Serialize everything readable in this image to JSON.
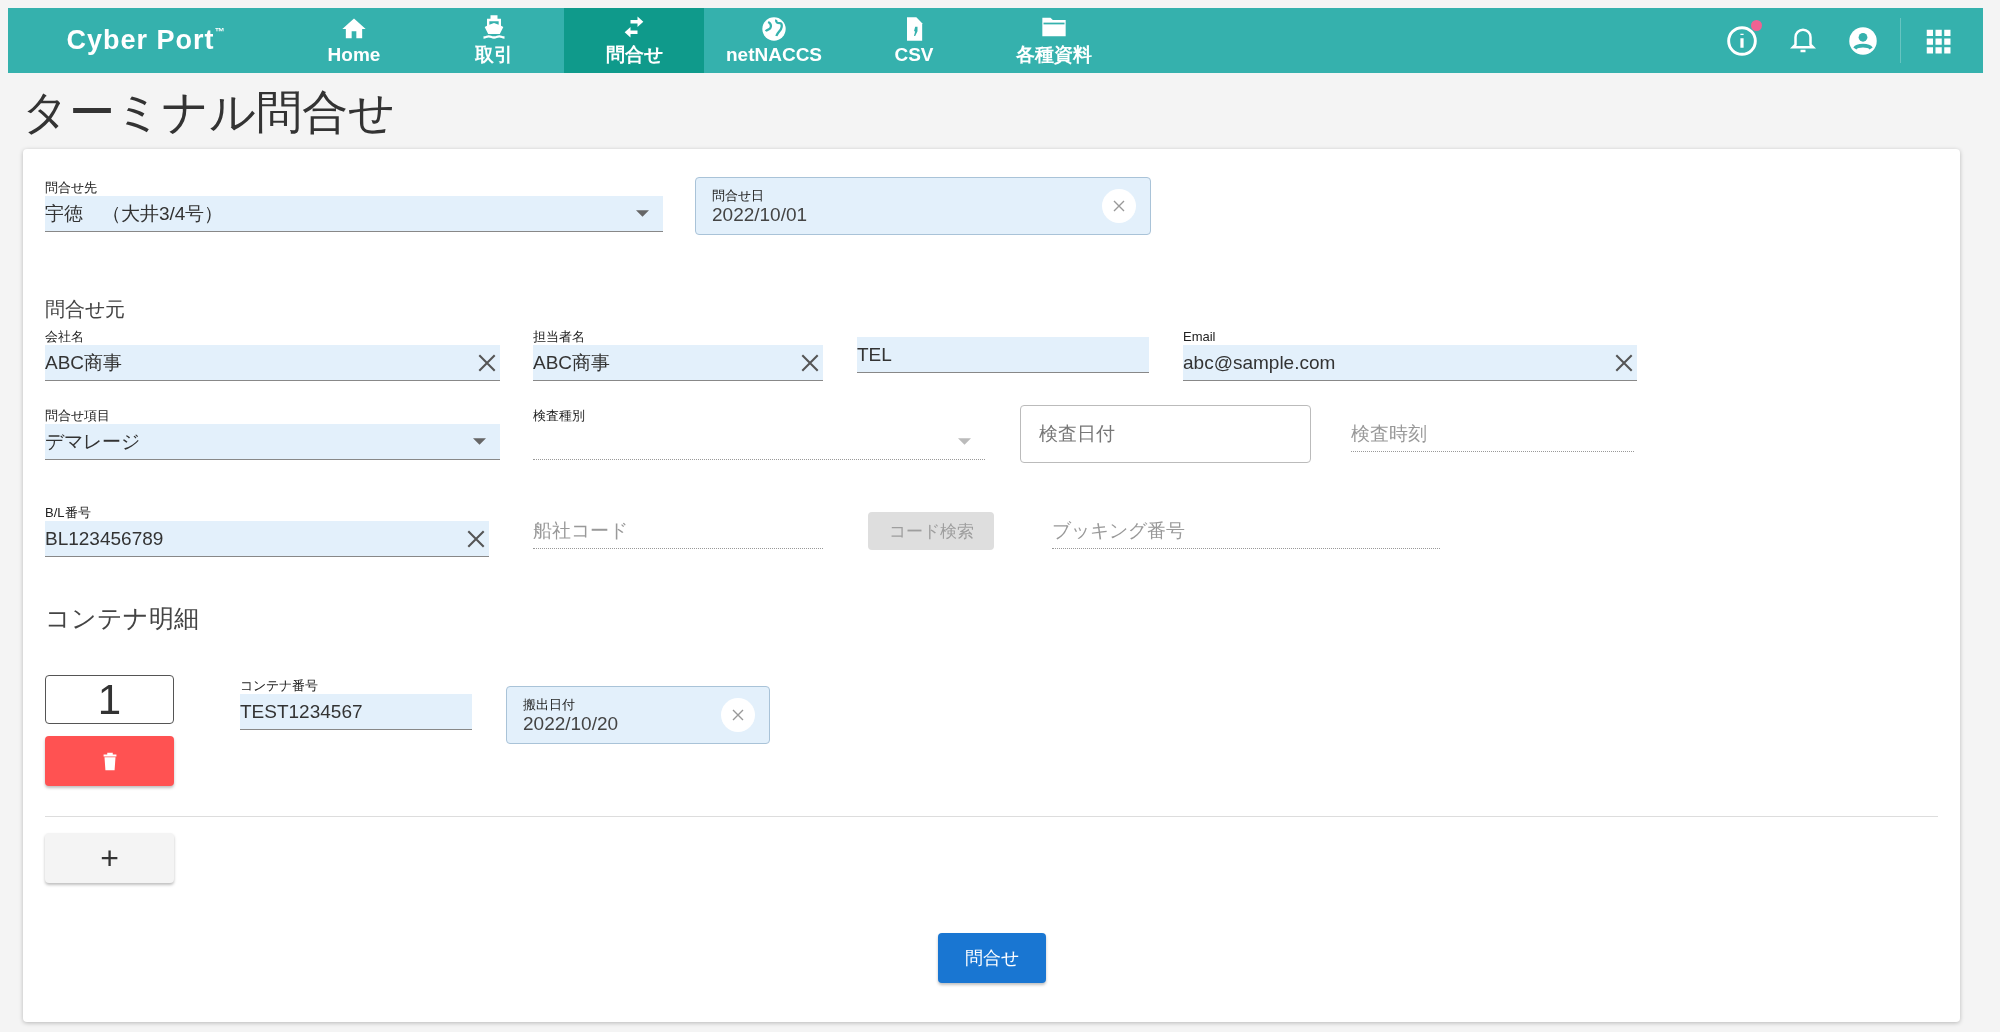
{
  "nav": {
    "logo": "Cyber Port",
    "logo_mark": "™",
    "info_badge": true,
    "tabs": [
      {
        "label": "Home",
        "kind": "home",
        "selected": false
      },
      {
        "label": "取引",
        "kind": "ship",
        "selected": false
      },
      {
        "label": "問合せ",
        "kind": "swap",
        "selected": true
      },
      {
        "label": "netNACCS",
        "kind": "globe",
        "selected": false
      },
      {
        "label": "CSV",
        "kind": "file",
        "selected": false
      },
      {
        "label": "各種資料",
        "kind": "folder",
        "selected": false
      }
    ]
  },
  "page_title": "ターミナル問合せ",
  "form": {
    "top_row": [
      {
        "kind": "select",
        "label": "問合せ先",
        "value": "宇徳　（大井3/4号）",
        "disabled": false
      },
      {
        "kind": "date",
        "label": "問合せ日",
        "value": "2022/10/01",
        "clearable": true
      }
    ],
    "sender": {
      "heading": "問合せ元",
      "rows": [
        [
          {
            "kind": "text",
            "label": "会社名",
            "value": "ABC商事",
            "clearable": true,
            "disabled": false
          },
          {
            "kind": "text",
            "label": "担当者名",
            "value": "ABC商事",
            "clearable": true,
            "disabled": false
          },
          {
            "kind": "text",
            "value": "TEL",
            "clearable": false,
            "disabled": false
          },
          {
            "kind": "text",
            "label": "Email",
            "value": "abc@sample.com",
            "clearable": true,
            "disabled": false
          }
        ],
        [
          {
            "kind": "select",
            "label": "問合せ項目",
            "value": "デマレージ",
            "disabled": false
          },
          {
            "kind": "select",
            "label": "検査種別",
            "disabled": true
          },
          {
            "kind": "outlined",
            "placeholder": "検査日付"
          },
          {
            "kind": "text",
            "placeholder": "検査時刻",
            "clearable": false,
            "disabled": true
          }
        ],
        [
          {
            "kind": "text",
            "label": "B/L番号",
            "value": "BL123456789",
            "clearable": true,
            "disabled": false
          },
          {
            "kind": "text",
            "placeholder": "船社コード",
            "clearable": false,
            "disabled": true
          },
          {
            "kind": "button",
            "label": "コード検索",
            "disabled": true
          },
          {
            "kind": "text",
            "placeholder": "ブッキング番号",
            "clearable": false,
            "disabled": true
          }
        ]
      ]
    },
    "containers": {
      "heading": "コンテナ明細",
      "items": [
        {
          "number": "1",
          "fields": [
            {
              "kind": "text",
              "label": "コンテナ番号",
              "value": "TEST1234567",
              "clearable": false,
              "disabled": false
            },
            {
              "kind": "date",
              "label": "搬出日付",
              "value": "2022/10/20",
              "clearable": true
            }
          ]
        }
      ],
      "add_button": "+"
    },
    "submit": "問合せ"
  }
}
